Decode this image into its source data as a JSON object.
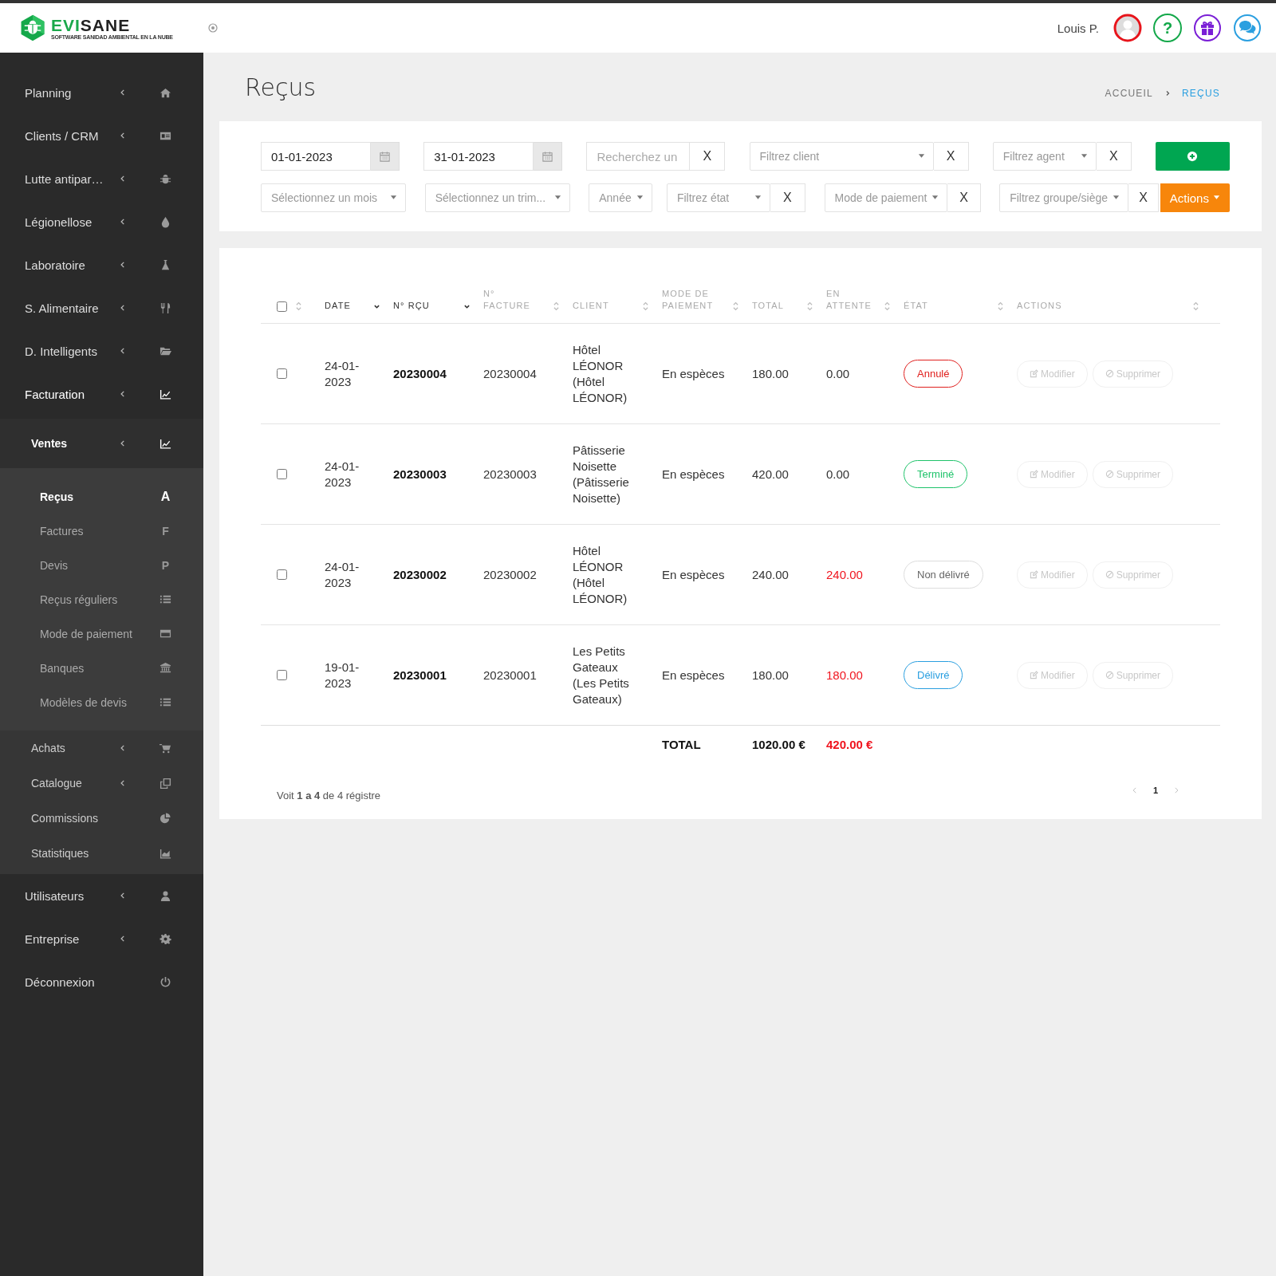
{
  "header": {
    "brand_accent": "EVI",
    "brand_rest": "SANE",
    "tagline": "SOFTWARE SANIDAD AMBIENTAL EN LA NUBE",
    "user_name": "Louis P.",
    "help": "?"
  },
  "sidebar": {
    "items": [
      {
        "label": "Planning",
        "expanded": false
      },
      {
        "label": "Clients / CRM",
        "expanded": false
      },
      {
        "label": "Lutte antipar…",
        "expanded": false
      },
      {
        "label": "Légionellose",
        "expanded": false
      },
      {
        "label": "Laboratoire",
        "expanded": false
      },
      {
        "label": "S. Alimentaire",
        "expanded": false
      },
      {
        "label": "D. Intelligents",
        "expanded": false
      },
      {
        "label": "Facturation",
        "expanded": true,
        "children": [
          {
            "label": "Ventes",
            "expanded": true,
            "children": [
              {
                "label": "Reçus",
                "badge": "A",
                "selected": true
              },
              {
                "label": "Factures",
                "badge": "F",
                "selected": false
              },
              {
                "label": "Devis",
                "badge": "P",
                "selected": false
              },
              {
                "label": "Reçus réguliers",
                "selected": false
              },
              {
                "label": "Mode de paiement",
                "selected": false
              },
              {
                "label": "Banques",
                "selected": false
              },
              {
                "label": "Modèles de devis",
                "selected": false
              }
            ]
          },
          {
            "label": "Achats",
            "expanded": false
          },
          {
            "label": "Catalogue",
            "expanded": false
          },
          {
            "label": "Commissions"
          },
          {
            "label": "Statistiques"
          }
        ]
      },
      {
        "label": "Utilisateurs",
        "expanded": false
      },
      {
        "label": "Entreprise",
        "expanded": false
      },
      {
        "label": "Déconnexion"
      }
    ]
  },
  "page": {
    "title": "Reçus",
    "breadcrumb": [
      {
        "label": "ACCUEIL",
        "current": false
      },
      {
        "label": "REÇUS",
        "current": true
      }
    ]
  },
  "filters": {
    "first_row": [
      {
        "kind": "date",
        "value": "01-01-2023"
      },
      {
        "kind": "date",
        "value": "31-01-2023"
      },
      {
        "kind": "search",
        "placeholder": "Recherchez un",
        "clear": "X"
      },
      {
        "kind": "select",
        "placeholder": "Filtrez client",
        "clear": "X"
      },
      {
        "kind": "select",
        "placeholder": "Filtrez agent",
        "clear": "X"
      },
      {
        "kind": "add"
      }
    ],
    "second_row": [
      {
        "kind": "select",
        "placeholder": "Sélectionnez un mois"
      },
      {
        "kind": "select",
        "placeholder": "Sélectionnez un trim..."
      },
      {
        "kind": "select",
        "placeholder": "Année"
      },
      {
        "kind": "select",
        "placeholder": "Filtrez état",
        "clear": "X"
      },
      {
        "kind": "select",
        "placeholder": "Mode de paiement",
        "clear": "X"
      },
      {
        "kind": "select",
        "placeholder": "Filtrez groupe/siège",
        "clear": "X"
      },
      {
        "kind": "actions",
        "label": "Actions"
      }
    ]
  },
  "table": {
    "select_all": {
      "checked": false
    },
    "columns": [
      {
        "label": "DATE",
        "sorted": true
      },
      {
        "label": "N° RÇU",
        "sorted": true
      },
      {
        "label": "N° FACTURE",
        "sorted": false
      },
      {
        "label": "CLIENT",
        "sorted": false
      },
      {
        "label": "MODE DE PAIEMENT",
        "sorted": false
      },
      {
        "label": "TOTAL",
        "sorted": false
      },
      {
        "label": "EN ATTENTE",
        "sorted": false
      },
      {
        "label": "ÉTAT",
        "sorted": false
      },
      {
        "label": "ACTIONS",
        "sorted": false
      }
    ],
    "rows": [
      {
        "checked": false,
        "date": "24-01-2023",
        "receipt": "20230004",
        "invoice": "20230004",
        "client": "Hôtel LÉONOR (Hôtel LÉONOR)",
        "payment": "En espèces",
        "total": "180.00",
        "pending": "0.00",
        "pending_due": false,
        "status": {
          "label": "Annulé",
          "color": "#e0201e"
        },
        "actions": [
          {
            "label": "Modifier",
            "disabled": true
          },
          {
            "label": "Supprimer",
            "disabled": true
          }
        ]
      },
      {
        "checked": false,
        "date": "24-01-2023",
        "receipt": "20230003",
        "invoice": "20230003",
        "client": "Pâtisserie Noisette (Pâtisserie Noisette)",
        "payment": "En espèces",
        "total": "420.00",
        "pending": "0.00",
        "pending_due": false,
        "status": {
          "label": "Terminé",
          "color": "#1ec36a"
        },
        "actions": [
          {
            "label": "Modifier",
            "disabled": true
          },
          {
            "label": "Supprimer",
            "disabled": true
          }
        ]
      },
      {
        "checked": false,
        "date": "24-01-2023",
        "receipt": "20230002",
        "invoice": "20230002",
        "client": "Hôtel LÉONOR (Hôtel LÉONOR)",
        "payment": "En espèces",
        "total": "240.00",
        "pending": "240.00",
        "pending_due": true,
        "status": {
          "label": "Non délivré",
          "color": "#666666"
        },
        "actions": [
          {
            "label": "Modifier",
            "disabled": true
          },
          {
            "label": "Supprimer",
            "disabled": true
          }
        ]
      },
      {
        "checked": false,
        "date": "19-01-2023",
        "receipt": "20230001",
        "invoice": "20230001",
        "client": "Les Petits Gateaux (Les Petits Gateaux)",
        "payment": "En espèces",
        "total": "180.00",
        "pending": "180.00",
        "pending_due": true,
        "status": {
          "label": "Délivré",
          "color": "#2a9fe0"
        },
        "actions": [
          {
            "label": "Modifier",
            "disabled": true
          },
          {
            "label": "Supprimer",
            "disabled": true
          }
        ]
      }
    ],
    "totals": {
      "label": "TOTAL",
      "total": "1020.00 €",
      "pending": "420.00 €"
    },
    "info": "Voit **1 a 4** de 4 régistre",
    "pages": [
      {
        "label": "1",
        "selected": true
      }
    ]
  }
}
